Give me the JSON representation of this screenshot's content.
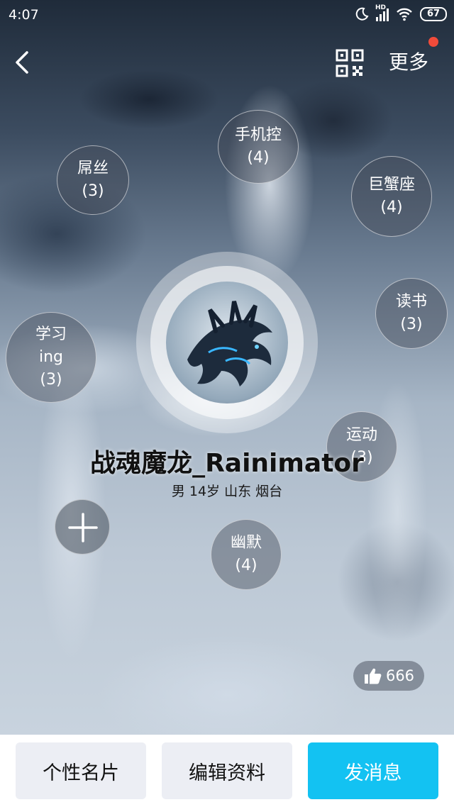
{
  "status_bar": {
    "time": "4:07",
    "network": "HD",
    "battery": "67"
  },
  "navbar": {
    "more_label": "更多"
  },
  "tags": [
    {
      "label_lines": [
        "手机控",
        "(4)"
      ]
    },
    {
      "label_lines": [
        "屌丝",
        "(3)"
      ]
    },
    {
      "label_lines": [
        "巨蟹座",
        "(4)"
      ]
    },
    {
      "label_lines": [
        "读书",
        "(3)"
      ]
    },
    {
      "label_lines": [
        "学习",
        "ing",
        "(3)"
      ]
    },
    {
      "label_lines": [
        "运动",
        "(3)"
      ]
    },
    {
      "label_lines": [
        "幽默",
        "(4)"
      ]
    }
  ],
  "profile": {
    "nickname": "战魂魔龙_Rainimator",
    "info": "男 14岁 山东 烟台"
  },
  "likes": {
    "count": "666"
  },
  "bottom_bar": {
    "card_label": "个性名片",
    "edit_label": "编辑资料",
    "message_label": "发消息"
  },
  "colors": {
    "primary": "#13c2f2",
    "notification_dot": "#f04b3a"
  }
}
